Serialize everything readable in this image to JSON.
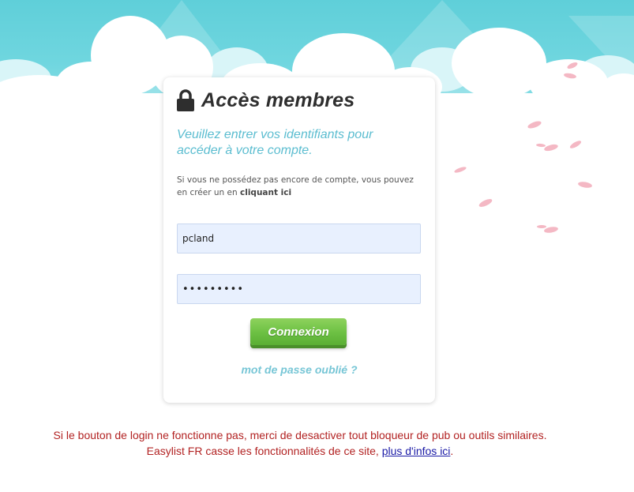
{
  "header": {
    "title": "Accès membres",
    "lock_icon": "lock-icon"
  },
  "login": {
    "subtitle": "Veuillez entrer vos identifiants pour accéder à votre compte.",
    "info_text": "Si vous ne possédez pas encore de compte, vous pouvez en créer un en ",
    "info_link": "cliquant ici",
    "username": {
      "value": "pcland"
    },
    "password": {
      "value": "•••••••••"
    },
    "submit_label": "Connexion",
    "forgot_label": "mot de passe oublié ?"
  },
  "warning": {
    "line1": "Si le bouton de login ne fonctionne pas, merci de desactiver tout bloqueur de pub ou outils similaires.",
    "line2": "Easylist FR casse les fonctionnalités de ce site, ",
    "link": "plus d'infos ici",
    "end": "."
  },
  "colors": {
    "sky": "#5fcfd9",
    "accent": "#5bbdd0",
    "button": "#6cc043",
    "warning": "#b22222",
    "link": "#1a1aa6"
  }
}
